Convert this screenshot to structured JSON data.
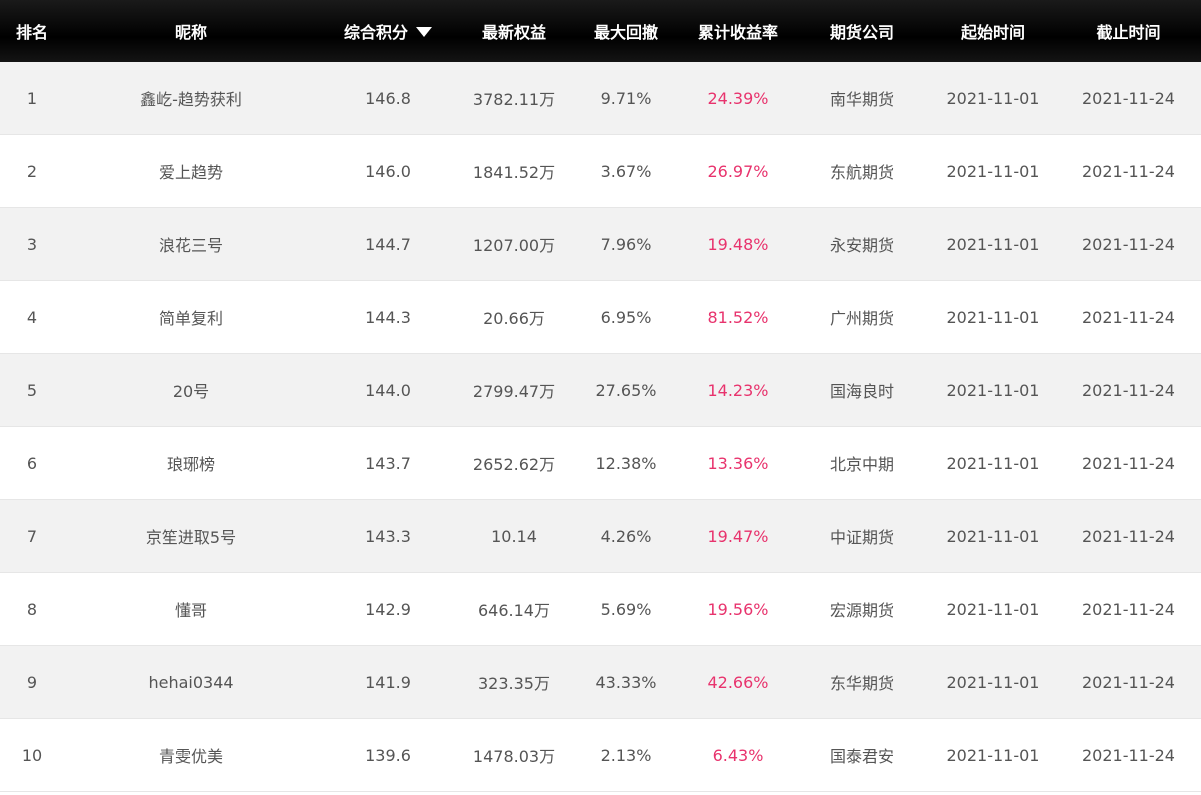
{
  "columns": {
    "rank": "排名",
    "name": "昵称",
    "score": "综合积分",
    "equity": "最新权益",
    "drawdown": "最大回撤",
    "return": "累计收益率",
    "company": "期货公司",
    "start": "起始时间",
    "end": "截止时间"
  },
  "sort_icon": "triangle-down-icon",
  "colors": {
    "header_bg": "#000000",
    "return_color": "#e8336d",
    "row_alt": "#f2f2f2"
  },
  "rows": [
    {
      "rank": "1",
      "name": "鑫屹-趋势获利",
      "score": "146.8",
      "equity": "3782.11万",
      "drawdown": "9.71%",
      "return": "24.39%",
      "company": "南华期货",
      "start": "2021-11-01",
      "end": "2021-11-24"
    },
    {
      "rank": "2",
      "name": "爱上趋势",
      "score": "146.0",
      "equity": "1841.52万",
      "drawdown": "3.67%",
      "return": "26.97%",
      "company": "东航期货",
      "start": "2021-11-01",
      "end": "2021-11-24"
    },
    {
      "rank": "3",
      "name": "浪花三号",
      "score": "144.7",
      "equity": "1207.00万",
      "drawdown": "7.96%",
      "return": "19.48%",
      "company": "永安期货",
      "start": "2021-11-01",
      "end": "2021-11-24"
    },
    {
      "rank": "4",
      "name": "简单复利",
      "score": "144.3",
      "equity": "20.66万",
      "drawdown": "6.95%",
      "return": "81.52%",
      "company": "广州期货",
      "start": "2021-11-01",
      "end": "2021-11-24"
    },
    {
      "rank": "5",
      "name": "20号",
      "score": "144.0",
      "equity": "2799.47万",
      "drawdown": "27.65%",
      "return": "14.23%",
      "company": "国海良时",
      "start": "2021-11-01",
      "end": "2021-11-24"
    },
    {
      "rank": "6",
      "name": "琅琊榜",
      "score": "143.7",
      "equity": "2652.62万",
      "drawdown": "12.38%",
      "return": "13.36%",
      "company": "北京中期",
      "start": "2021-11-01",
      "end": "2021-11-24"
    },
    {
      "rank": "7",
      "name": "京笙进取5号",
      "score": "143.3",
      "equity": "10.14",
      "drawdown": "4.26%",
      "return": "19.47%",
      "company": "中证期货",
      "start": "2021-11-01",
      "end": "2021-11-24"
    },
    {
      "rank": "8",
      "name": "懂哥",
      "score": "142.9",
      "equity": "646.14万",
      "drawdown": "5.69%",
      "return": "19.56%",
      "company": "宏源期货",
      "start": "2021-11-01",
      "end": "2021-11-24"
    },
    {
      "rank": "9",
      "name": "hehai0344",
      "score": "141.9",
      "equity": "323.35万",
      "drawdown": "43.33%",
      "return": "42.66%",
      "company": "东华期货",
      "start": "2021-11-01",
      "end": "2021-11-24"
    },
    {
      "rank": "10",
      "name": "青雯优美",
      "score": "139.6",
      "equity": "1478.03万",
      "drawdown": "2.13%",
      "return": "6.43%",
      "company": "国泰君安",
      "start": "2021-11-01",
      "end": "2021-11-24"
    }
  ]
}
